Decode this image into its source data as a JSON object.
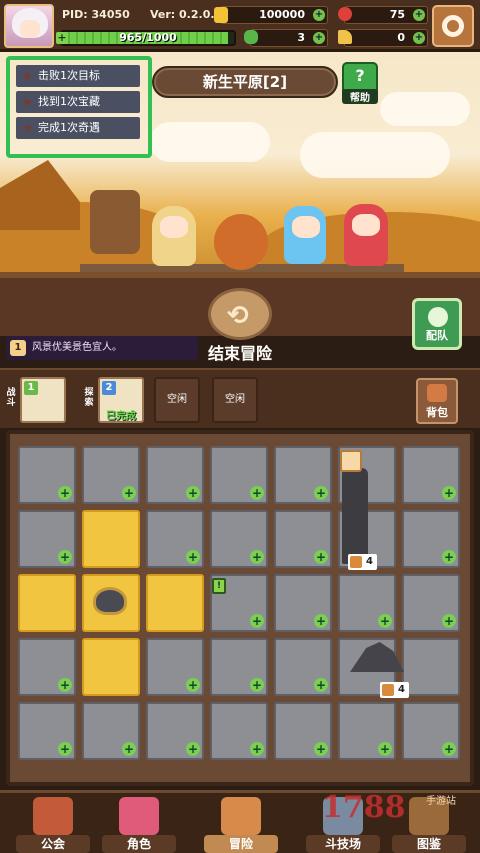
{
  "player": {
    "pid": "PID: 34050",
    "version": "Ver: 0.2.0.3",
    "xp_text": "965/1000",
    "xp_fraction": 0.965
  },
  "resources": {
    "gold": "100000",
    "gems": "75",
    "clover": "3",
    "keys": "0"
  },
  "quests": [
    {
      "label": "击败1次目标"
    },
    {
      "label": "找到1次宝藏"
    },
    {
      "label": "完成1次奇遇"
    }
  ],
  "area": {
    "name": "新生平原[2]",
    "help_label": "帮助"
  },
  "message": {
    "num": "1",
    "text": "风景优美景色宜人。"
  },
  "actions": {
    "end_label": "结束冒险",
    "team_label": "配队",
    "bag_label": "背包"
  },
  "slots": {
    "battle_label": "战斗",
    "explore_label": "探索",
    "battle_badge": "1",
    "explore_badge": "2",
    "explore_done": "已完成",
    "empty1": "空闲",
    "empty2": "空闲"
  },
  "board": {
    "tag1": "4",
    "tag2": "4",
    "marker": "!"
  },
  "nav": [
    {
      "label": "公会"
    },
    {
      "label": "角色"
    },
    {
      "label": "冒险"
    },
    {
      "label": "斗技场"
    },
    {
      "label": "图鉴"
    }
  ],
  "watermark": {
    "text": "1788",
    "subtext": "手游站"
  },
  "colors": {
    "highlight_border": "#32c052",
    "gold_tile": "#f1c540",
    "stone_tile": "#8e8f94"
  }
}
